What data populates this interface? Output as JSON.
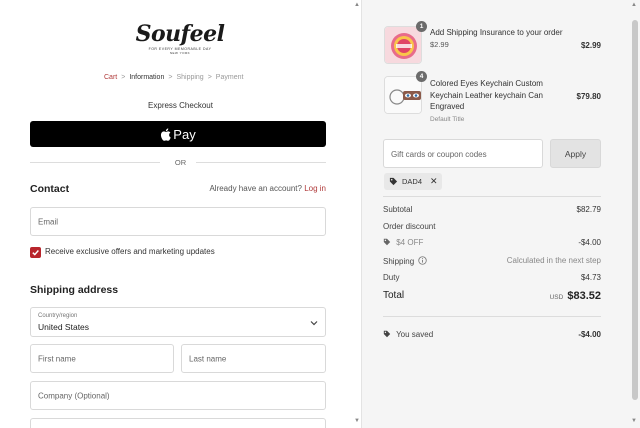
{
  "brand": {
    "logo_main": "Soufeel",
    "tagline": "FOR EVERY MEMORABLE DAY",
    "location": "NEW YORK"
  },
  "breadcrumb": {
    "cart": "Cart",
    "information": "Information",
    "shipping": "Shipping",
    "payment": "Payment",
    "separator": ">"
  },
  "express_checkout": {
    "title": "Express Checkout",
    "apple_pay_label": "Pay",
    "or_label": "OR"
  },
  "contact": {
    "title": "Contact",
    "account_prompt": "Already have an account?",
    "login_label": "Log in",
    "email_placeholder": "Email",
    "marketing_opt_in_label": "Receive exclusive offers and marketing updates",
    "marketing_opt_in_checked": true
  },
  "shipping_address": {
    "title": "Shipping address",
    "country_label": "Country/region",
    "country_value": "United States",
    "first_name_placeholder": "First name",
    "last_name_placeholder": "Last name",
    "company_placeholder": "Company (Optional)"
  },
  "order_summary": {
    "items": [
      {
        "quantity": "1",
        "title": "Add Shipping Insurance to your order",
        "subprice": "$2.99",
        "price": "$2.99"
      },
      {
        "quantity": "4",
        "title_lines": [
          "Colored Eyes Keychain Custom",
          "Keychain Leather keychain Can",
          "Engraved"
        ],
        "variant": "Default Title",
        "price": "$79.80"
      }
    ],
    "coupon_placeholder": "Gift cards or coupon codes",
    "apply_label": "Apply",
    "applied_code": "DAD4",
    "subtotal_label": "Subtotal",
    "subtotal_value": "$82.79",
    "order_discount_label": "Order discount",
    "discount_code_label": "$4 OFF",
    "discount_value": "-$4.00",
    "shipping_label": "Shipping",
    "shipping_value": "Calculated in the next step",
    "duty_label": "Duty",
    "duty_value": "$4.73",
    "total_label": "Total",
    "currency": "USD",
    "total_value": "$83.52",
    "saved_label": "You saved",
    "saved_value": "-$4.00"
  },
  "colors": {
    "accent_red": "#b8252c",
    "link_red": "#b03a3a",
    "apple_pay_bg": "#000000",
    "summary_bg": "#f5f5f5"
  }
}
